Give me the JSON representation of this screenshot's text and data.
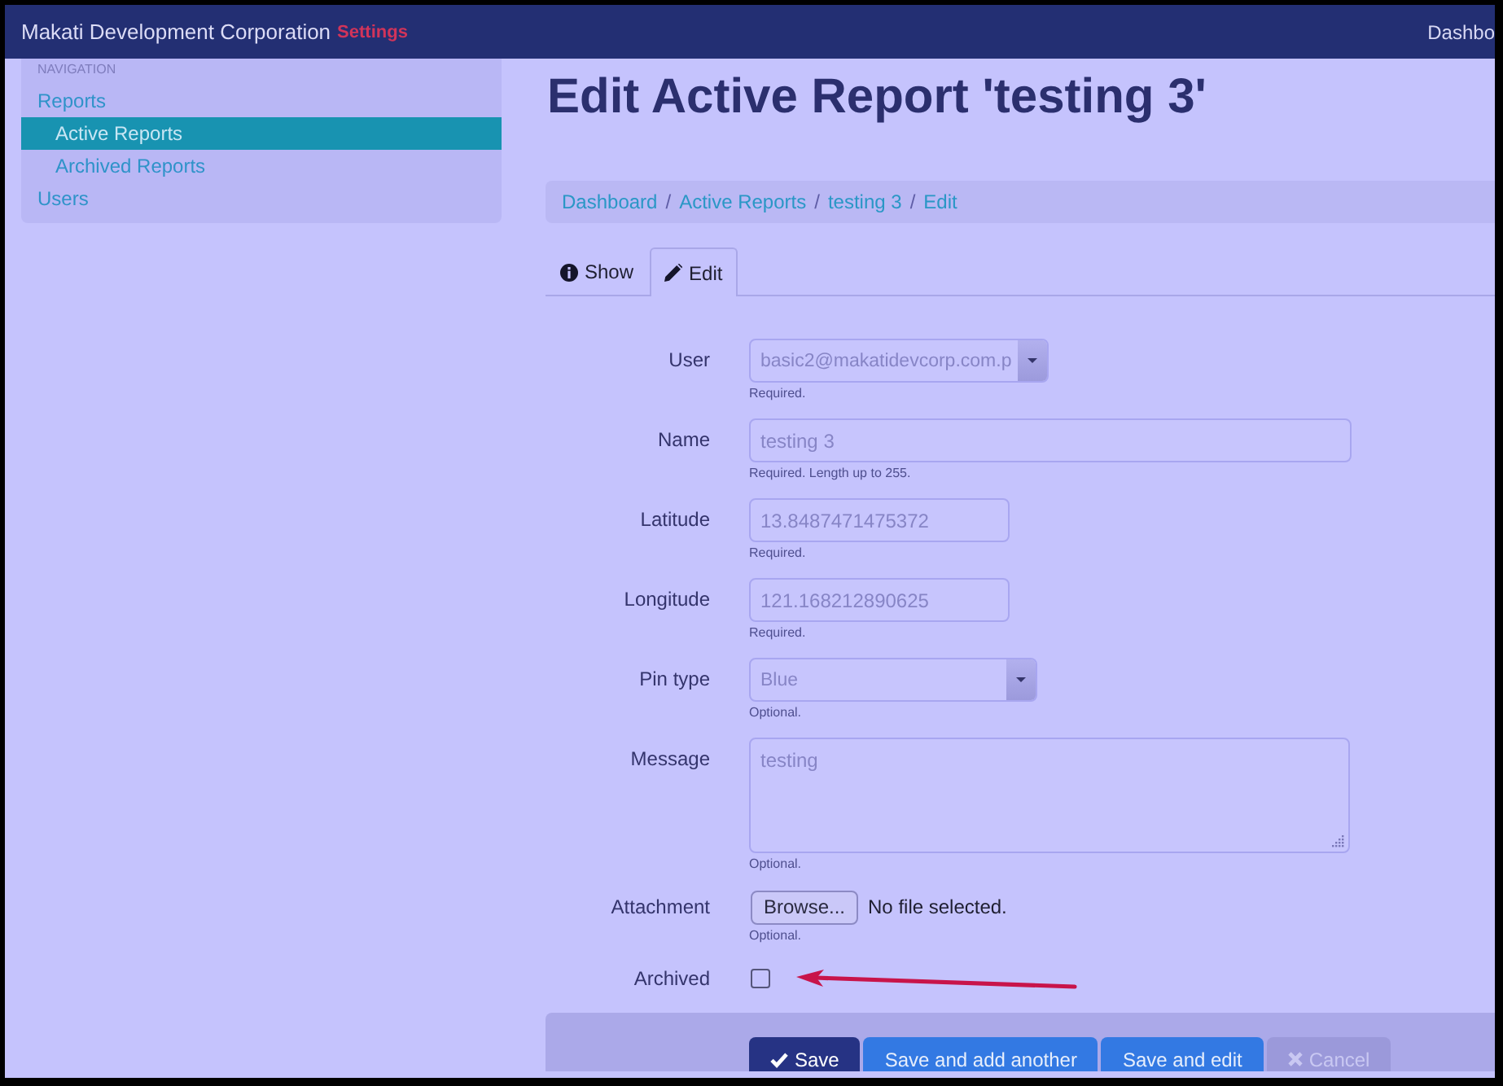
{
  "navbar": {
    "brand": "Makati Development Corporation",
    "section": "Settings",
    "link": "Dashbo"
  },
  "sidebar": {
    "heading": "NAVIGATION",
    "items": [
      {
        "label": "Reports",
        "selected": false,
        "children": [
          {
            "label": "Active Reports",
            "selected": true
          },
          {
            "label": "Archived Reports",
            "selected": false
          }
        ]
      },
      {
        "label": "Users",
        "selected": false
      }
    ]
  },
  "page_title": "Edit Active Report 'testing 3'",
  "breadcrumb": {
    "separator": "/",
    "items": [
      "Dashboard",
      "Active Reports",
      "testing 3",
      "Edit"
    ]
  },
  "tabs": [
    {
      "label": "Show",
      "kind": "view",
      "selected": false
    },
    {
      "label": "Edit",
      "kind": "edit",
      "selected": true
    }
  ],
  "form": {
    "fields": [
      {
        "kind": "select",
        "label": "User",
        "value": "basic2@makatidevcorp.com.p",
        "help": "Required."
      },
      {
        "kind": "text",
        "label": "Name",
        "value": "testing 3",
        "help": "Required. Length up to 255."
      },
      {
        "kind": "number",
        "label": "Latitude",
        "value": "13.8487471475372",
        "help": "Required."
      },
      {
        "kind": "number",
        "label": "Longitude",
        "value": "121.168212890625",
        "help": "Required."
      },
      {
        "kind": "select",
        "label": "Pin type",
        "value": "Blue",
        "help": "Optional."
      },
      {
        "kind": "textarea",
        "label": "Message",
        "value": "testing",
        "help": "Optional."
      },
      {
        "kind": "file",
        "label": "Attachment",
        "button_label": "Browse...",
        "value": "No file selected.",
        "help": "Optional."
      },
      {
        "kind": "checkbox",
        "label": "Archived",
        "checked": false
      }
    ]
  },
  "actions": [
    {
      "label": "Save",
      "kind": "primary"
    },
    {
      "label": "Save and add another",
      "kind": "secondary"
    },
    {
      "label": "Save and edit",
      "kind": "secondary"
    },
    {
      "label": "Cancel",
      "kind": "cancel"
    }
  ]
}
